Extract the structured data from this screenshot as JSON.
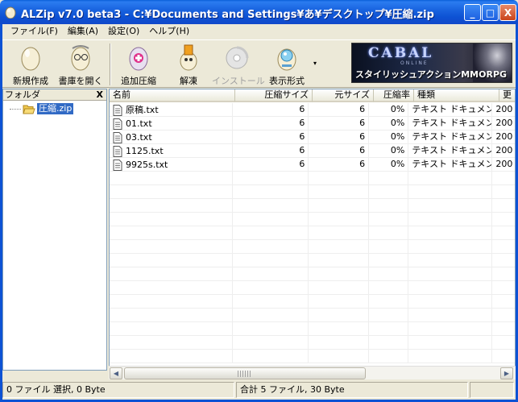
{
  "window": {
    "title": "ALZip v7.0 beta3 - C:¥Documents and Settings¥あ¥デスクトップ¥圧縮.zip",
    "minimize": "_",
    "maximize": "□",
    "close": "X"
  },
  "menu": {
    "items": [
      "ファイル(F)",
      "編集(A)",
      "設定(O)",
      "ヘルプ(H)"
    ]
  },
  "toolbar": {
    "new_label": "新規作成",
    "open_label": "書庫を開く",
    "add_label": "追加圧縮",
    "extract_label": "解凍",
    "install_label": "インストール",
    "view_label": "表示形式",
    "dropdown": "▾",
    "accent_color": "#316ac5"
  },
  "banner": {
    "logo": "CABAL",
    "sub": "ONLINE",
    "tagline": "スタイリッシュアクションMMORPG"
  },
  "folder_pane": {
    "header": "フォルダ",
    "close": "X",
    "tree_item": "圧縮.zip"
  },
  "list": {
    "columns": [
      "名前",
      "圧縮サイズ",
      "元サイズ",
      "圧縮率",
      "種類",
      "更"
    ],
    "rows": [
      {
        "name": "原稿.txt",
        "packed": "6",
        "size": "6",
        "ratio": "0%",
        "type": "テキスト ドキュメント",
        "date": "200"
      },
      {
        "name": "01.txt",
        "packed": "6",
        "size": "6",
        "ratio": "0%",
        "type": "テキスト ドキュメント",
        "date": "200"
      },
      {
        "name": "03.txt",
        "packed": "6",
        "size": "6",
        "ratio": "0%",
        "type": "テキスト ドキュメント",
        "date": "200"
      },
      {
        "name": "1125.txt",
        "packed": "6",
        "size": "6",
        "ratio": "0%",
        "type": "テキスト ドキュメント",
        "date": "200"
      },
      {
        "name": "9925s.txt",
        "packed": "6",
        "size": "6",
        "ratio": "0%",
        "type": "テキスト ドキュメント",
        "date": "200"
      }
    ]
  },
  "scrollbar": {
    "left": "◀",
    "right": "▶"
  },
  "status": {
    "selection": "0 ファイル 選択,  0 Byte",
    "total": "合計 5 ファイル,  30 Byte"
  }
}
